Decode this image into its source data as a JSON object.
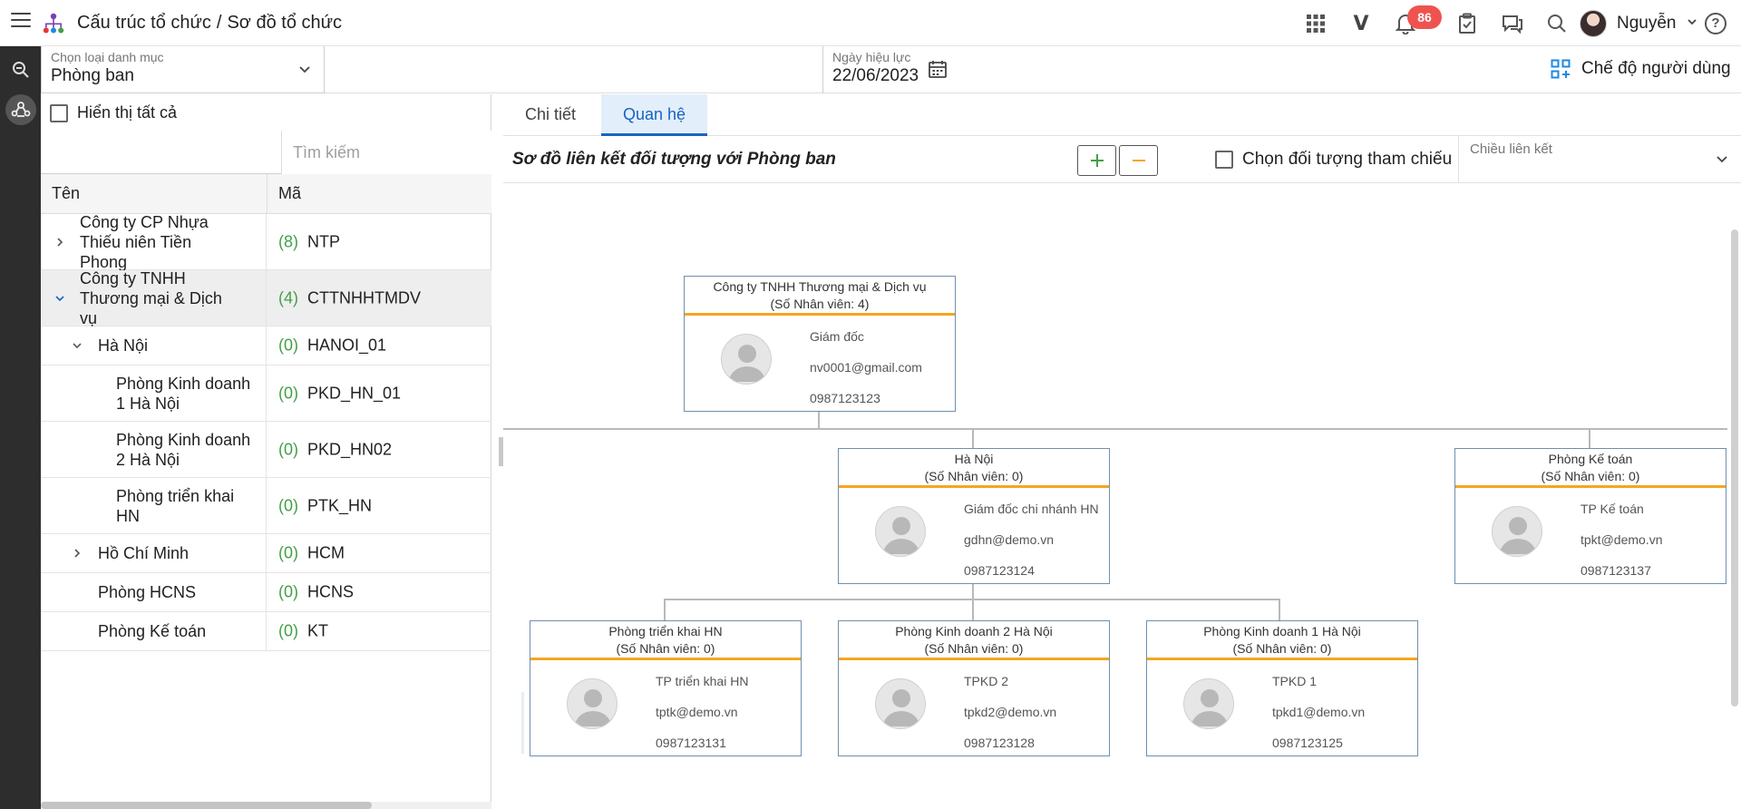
{
  "header": {
    "section": "Cấu trúc tổ chức",
    "separator": "/",
    "page": "Sơ đồ tổ chức",
    "v_label": "V",
    "notification_count": "86",
    "user_name": "Nguyễn",
    "help": "?"
  },
  "filters": {
    "category_label": "Chọn loại danh mục",
    "category_value": "Phòng ban",
    "date_label": "Ngày hiệu lực",
    "date_value": "22/06/2023",
    "user_mode": "Chế độ người dùng"
  },
  "left": {
    "show_all": "Hiển thị tất cả",
    "search_placeholder": "Tìm kiếm",
    "col_name": "Tên",
    "col_code": "Mã",
    "rows": [
      {
        "name": "Công ty CP Nhựa Thiếu niên Tiền Phong",
        "count": "(8)",
        "code": "NTP"
      },
      {
        "name": "Công ty TNHH Thương mại & Dịch vụ",
        "count": "(4)",
        "code": "CTTNHHTMDV"
      },
      {
        "name": "Hà Nội",
        "count": "(0)",
        "code": "HANOI_01"
      },
      {
        "name": "Phòng Kinh doanh 1 Hà Nội",
        "count": "(0)",
        "code": "PKD_HN_01"
      },
      {
        "name": "Phòng Kinh doanh 2 Hà Nội",
        "count": "(0)",
        "code": "PKD_HN02"
      },
      {
        "name": "Phòng triển khai HN",
        "count": "(0)",
        "code": "PTK_HN"
      },
      {
        "name": "Hồ Chí Minh",
        "count": "(0)",
        "code": "HCM"
      },
      {
        "name": "Phòng HCNS",
        "count": "(0)",
        "code": "HCNS"
      },
      {
        "name": "Phòng Kế toán",
        "count": "(0)",
        "code": "KT"
      }
    ]
  },
  "right": {
    "tabs": [
      "Chi tiết",
      "Quan hệ"
    ],
    "caption": "Sơ đồ liên kết đối tượng với Phòng ban",
    "ref_label": "Chọn đối tượng tham chiếu",
    "direction_label": "Chiều liên kết",
    "nodes": [
      {
        "title": "Công ty TNHH Thương mại & Dịch vụ",
        "staff": "(Số Nhân viên: 4)",
        "role": "Giám đốc",
        "email": "nv0001@gmail.com",
        "phone": "0987123123"
      },
      {
        "title": "Hà Nội",
        "staff": "(Số Nhân viên: 0)",
        "role": "Giám đốc chi nhánh HN",
        "email": "gdhn@demo.vn",
        "phone": "0987123124"
      },
      {
        "title": "Phòng Kế toán",
        "staff": "(Số Nhân viên: 0)",
        "role": "TP Kế toán",
        "email": "tpkt@demo.vn",
        "phone": "0987123137"
      },
      {
        "title": "Phòng triển khai HN",
        "staff": "(Số Nhân viên: 0)",
        "role": "TP triển khai HN",
        "email": "tptk@demo.vn",
        "phone": "0987123131"
      },
      {
        "title": "Phòng Kinh doanh 2 Hà Nội",
        "staff": "(Số Nhân viên: 0)",
        "role": "TPKD 2",
        "email": "tpkd2@demo.vn",
        "phone": "0987123128"
      },
      {
        "title": "Phòng Kinh doanh 1 Hà Nội",
        "staff": "(Số Nhân viên: 0)",
        "role": "TPKD 1",
        "email": "tpkd1@demo.vn",
        "phone": "0987123125"
      }
    ]
  },
  "colors": {
    "accent": "#1565c0",
    "node_divider": "#f5a623",
    "count_green": "#43a047",
    "badge": "#ef5350"
  }
}
